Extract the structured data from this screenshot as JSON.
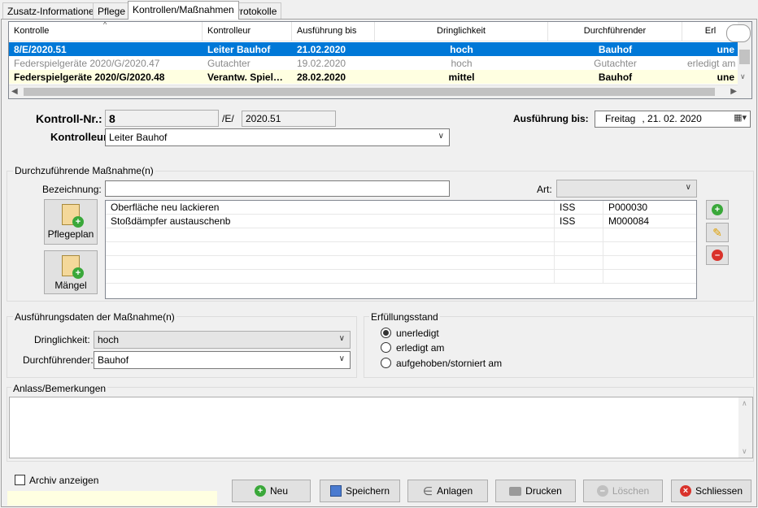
{
  "tabs": [
    "Zusatz-Informationen",
    "Pflege",
    "Kontrollen/Maßnahmen",
    "Protokolle"
  ],
  "grid": {
    "headers": [
      "Kontrolle",
      "Kontrolleur",
      "Ausführung bis",
      "Dringlichkeit",
      "Durchführender",
      "Erl"
    ],
    "rows": [
      [
        "8/E/2020.51",
        "Leiter Bauhof",
        "21.02.2020",
        "hoch",
        "Bauhof",
        "une"
      ],
      [
        "Federspielgeräte 2020/G/2020.47",
        "Gutachter",
        "19.02.2020",
        "hoch",
        "Gutachter",
        "erledigt am"
      ],
      [
        "Federspielgeräte 2020/G/2020.48",
        "Verantw. Spiel…",
        "28.02.2020",
        "mittel",
        "Bauhof",
        "une"
      ]
    ]
  },
  "kontrolle": {
    "nr_label": "Kontroll-Nr.:",
    "nr_value": "8",
    "sep": "/E/",
    "suffix": "2020.51",
    "kontrolleur_label": "Kontrolleur:",
    "kontrolleur_value": "Leiter Bauhof",
    "ausfuehrung_label": "Ausführung bis:",
    "ausfuehrung_day": "Freitag",
    "ausfuehrung_date": ", 21. 02. 2020"
  },
  "massnahme": {
    "group_label": "Durchzuführende Maßnahme(n)",
    "bezeichnung_label": "Bezeichnung:",
    "bezeichnung_value": "",
    "art_label": "Art:",
    "art_value": "",
    "pflegeplan_label": "Pflegeplan",
    "maengel_label": "Mängel",
    "items": [
      [
        "Oberfläche neu lackieren",
        "ISS",
        "P000030"
      ],
      [
        "Stoßdämpfer austauschenb",
        "ISS",
        "M000084"
      ]
    ]
  },
  "ausfuehrungsdaten": {
    "group_label": "Ausführungsdaten der Maßnahme(n)",
    "dringlichkeit_label": "Dringlichkeit:",
    "dringlichkeit_value": "hoch",
    "durchfuehrender_label": "Durchführender:",
    "durchfuehrender_value": "Bauhof"
  },
  "erfuellung": {
    "group_label": "Erfüllungsstand",
    "options": [
      "unerledigt",
      "erledigt am",
      "aufgehoben/storniert am"
    ],
    "selected": 0
  },
  "anlass": {
    "label": "Anlass/Bemerkungen",
    "value": ""
  },
  "archiv_label": "Archiv anzeigen",
  "buttons": {
    "neu": "Neu",
    "speichern": "Speichern",
    "anlagen": "Anlagen",
    "drucken": "Drucken",
    "loeschen": "Löschen",
    "schliessen": "Schliessen"
  },
  "colors": {
    "selection": "#0078d7",
    "highlight_row": "#ffffe1",
    "add": "#3aa83a",
    "remove": "#d9322b"
  }
}
